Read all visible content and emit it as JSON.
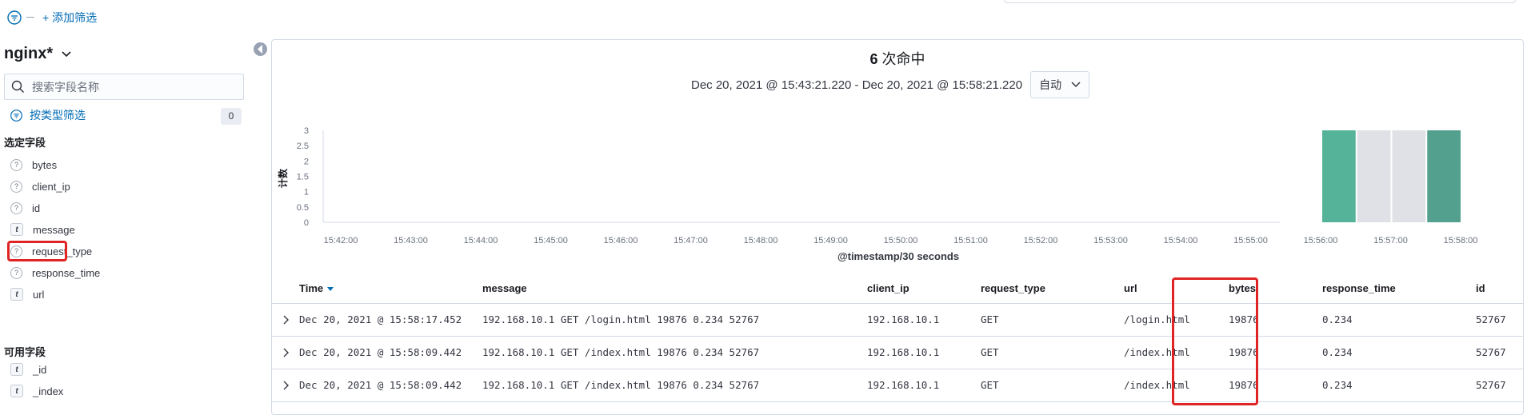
{
  "topbar": {
    "add_filter_label": "+ 添加筛选"
  },
  "sidebar": {
    "index_pattern": "nginx*",
    "search_placeholder": "搜索字段名称",
    "type_filter_label": "按类型筛选",
    "type_filter_count": "0",
    "selected_title": "选定字段",
    "selected_fields": [
      {
        "name": "bytes",
        "type": "?"
      },
      {
        "name": "client_ip",
        "type": "?"
      },
      {
        "name": "id",
        "type": "?"
      },
      {
        "name": "message",
        "type": "t"
      },
      {
        "name": "request_type",
        "type": "?"
      },
      {
        "name": "response_time",
        "type": "?"
      },
      {
        "name": "url",
        "type": "t"
      }
    ],
    "available_title": "可用字段",
    "available_fields": [
      {
        "name": "_id",
        "type": "t"
      },
      {
        "name": "_index",
        "type": "t"
      }
    ]
  },
  "main": {
    "hits_count": "6",
    "hits_label": "次命中",
    "range_text": "Dec 20, 2021 @ 15:43:21.220 - Dec 20, 2021 @ 15:58:21.220",
    "interval_label": "自动"
  },
  "chart_data": {
    "type": "bar",
    "ylabel": "计数",
    "xlabel": "@timestamp/30 seconds",
    "ylim": [
      0,
      3
    ],
    "yticks": [
      "0",
      "0.5",
      "1",
      "1.5",
      "2",
      "2.5",
      "3"
    ],
    "xticks": [
      "15:42:00",
      "15:43:00",
      "15:44:00",
      "15:45:00",
      "15:46:00",
      "15:47:00",
      "15:48:00",
      "15:49:00",
      "15:50:00",
      "15:51:00",
      "15:52:00",
      "15:53:00",
      "15:54:00",
      "15:55:00",
      "15:56:00",
      "15:57:00",
      "15:58:00"
    ],
    "bars": [
      {
        "x": "15:56:30",
        "value": 3,
        "color": "#54b399"
      },
      {
        "x": "15:57:00",
        "value": 3,
        "color": "#e0e1e6",
        "note_selection": true
      },
      {
        "x": "15:57:30",
        "value": 3,
        "color": "#e0e1e6",
        "note_selection": true
      },
      {
        "x": "15:58:00",
        "value": 3,
        "color": "#54a08f"
      }
    ]
  },
  "table": {
    "columns": [
      "Time",
      "message",
      "client_ip",
      "request_type",
      "url",
      "bytes",
      "response_time",
      "id"
    ],
    "rows": [
      [
        "Dec 20, 2021 @ 15:58:17.452",
        "192.168.10.1 GET /login.html 19876 0.234 52767",
        "192.168.10.1",
        "GET",
        "/login.html",
        "19876",
        "0.234",
        "52767"
      ],
      [
        "Dec 20, 2021 @ 15:58:09.442",
        "192.168.10.1 GET /index.html 19876 0.234 52767",
        "192.168.10.1",
        "GET",
        "/index.html",
        "19876",
        "0.234",
        "52767"
      ],
      [
        "Dec 20, 2021 @ 15:58:09.442",
        "192.168.10.1 GET /index.html 19876 0.234 52767",
        "192.168.10.1",
        "GET",
        "/index.html",
        "19876",
        "0.234",
        "52767"
      ]
    ]
  },
  "colors": {
    "accent": "#006bb4",
    "highlight": "#e02424",
    "bar": "#54b399"
  }
}
